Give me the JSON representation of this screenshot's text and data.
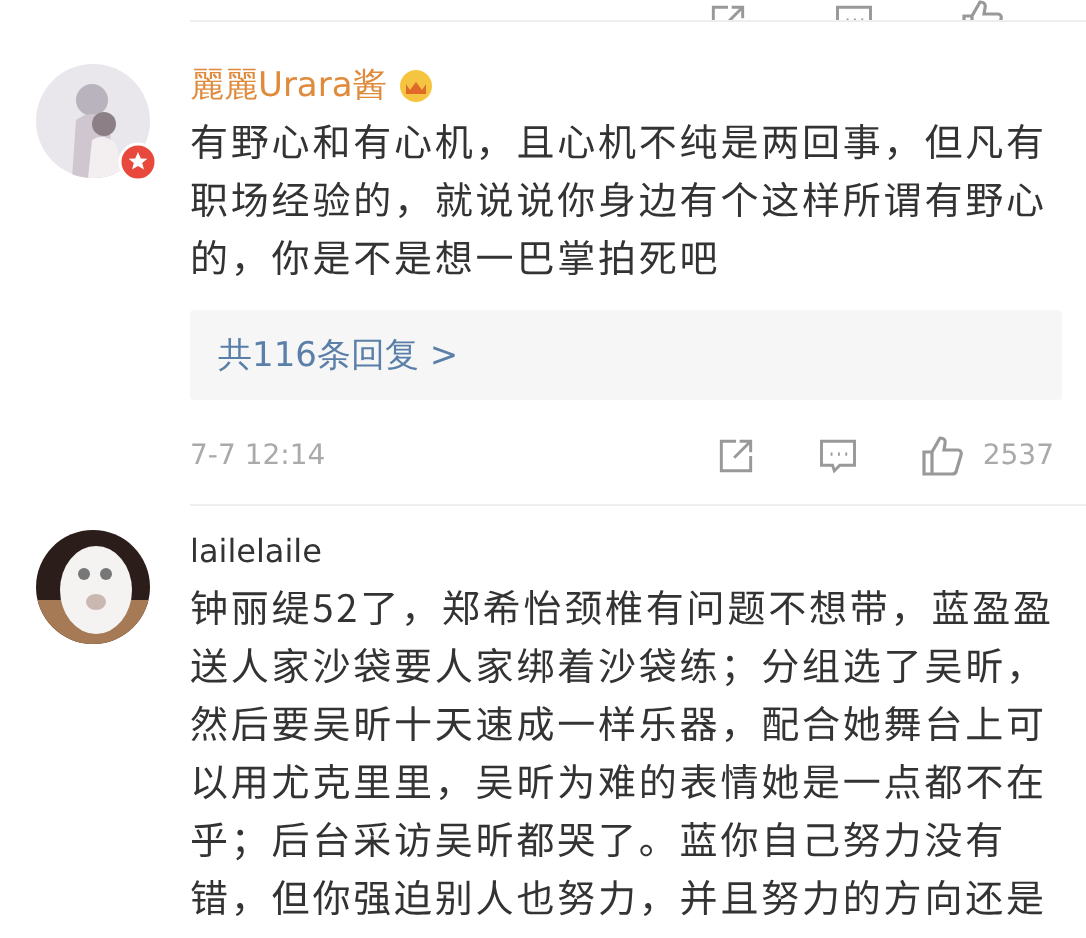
{
  "comments": [
    {
      "verified": true,
      "vip": true,
      "name": "麗麗Urara酱",
      "text_lines": [
        "有野心和有心机，且心机不纯是两回事，但凡有",
        "职场经验的，就说说你身边有个这样所谓有野心",
        "的，你是不是想一巴掌拍死吧"
      ],
      "replies": "共116条回复 >",
      "time": "7-7 12:14",
      "likes": "2537"
    },
    {
      "verified": false,
      "vip": false,
      "name": "lailelaile",
      "text_lines": [
        "钟丽缇52了，郑希怡颈椎有问题不想带，蓝盈盈",
        "送人家沙袋要人家绑着沙袋练；分组选了吴昕，",
        "然后要吴昕十天速成一样乐器，配合她舞台上可",
        "以用尤克里里，吴昕为难的表情她是一点都不在",
        "乎；后台采访吴昕都哭了。蓝你自己努力没有",
        "错，但你强迫别人也努力，并且努力的方向还是"
      ]
    }
  ]
}
